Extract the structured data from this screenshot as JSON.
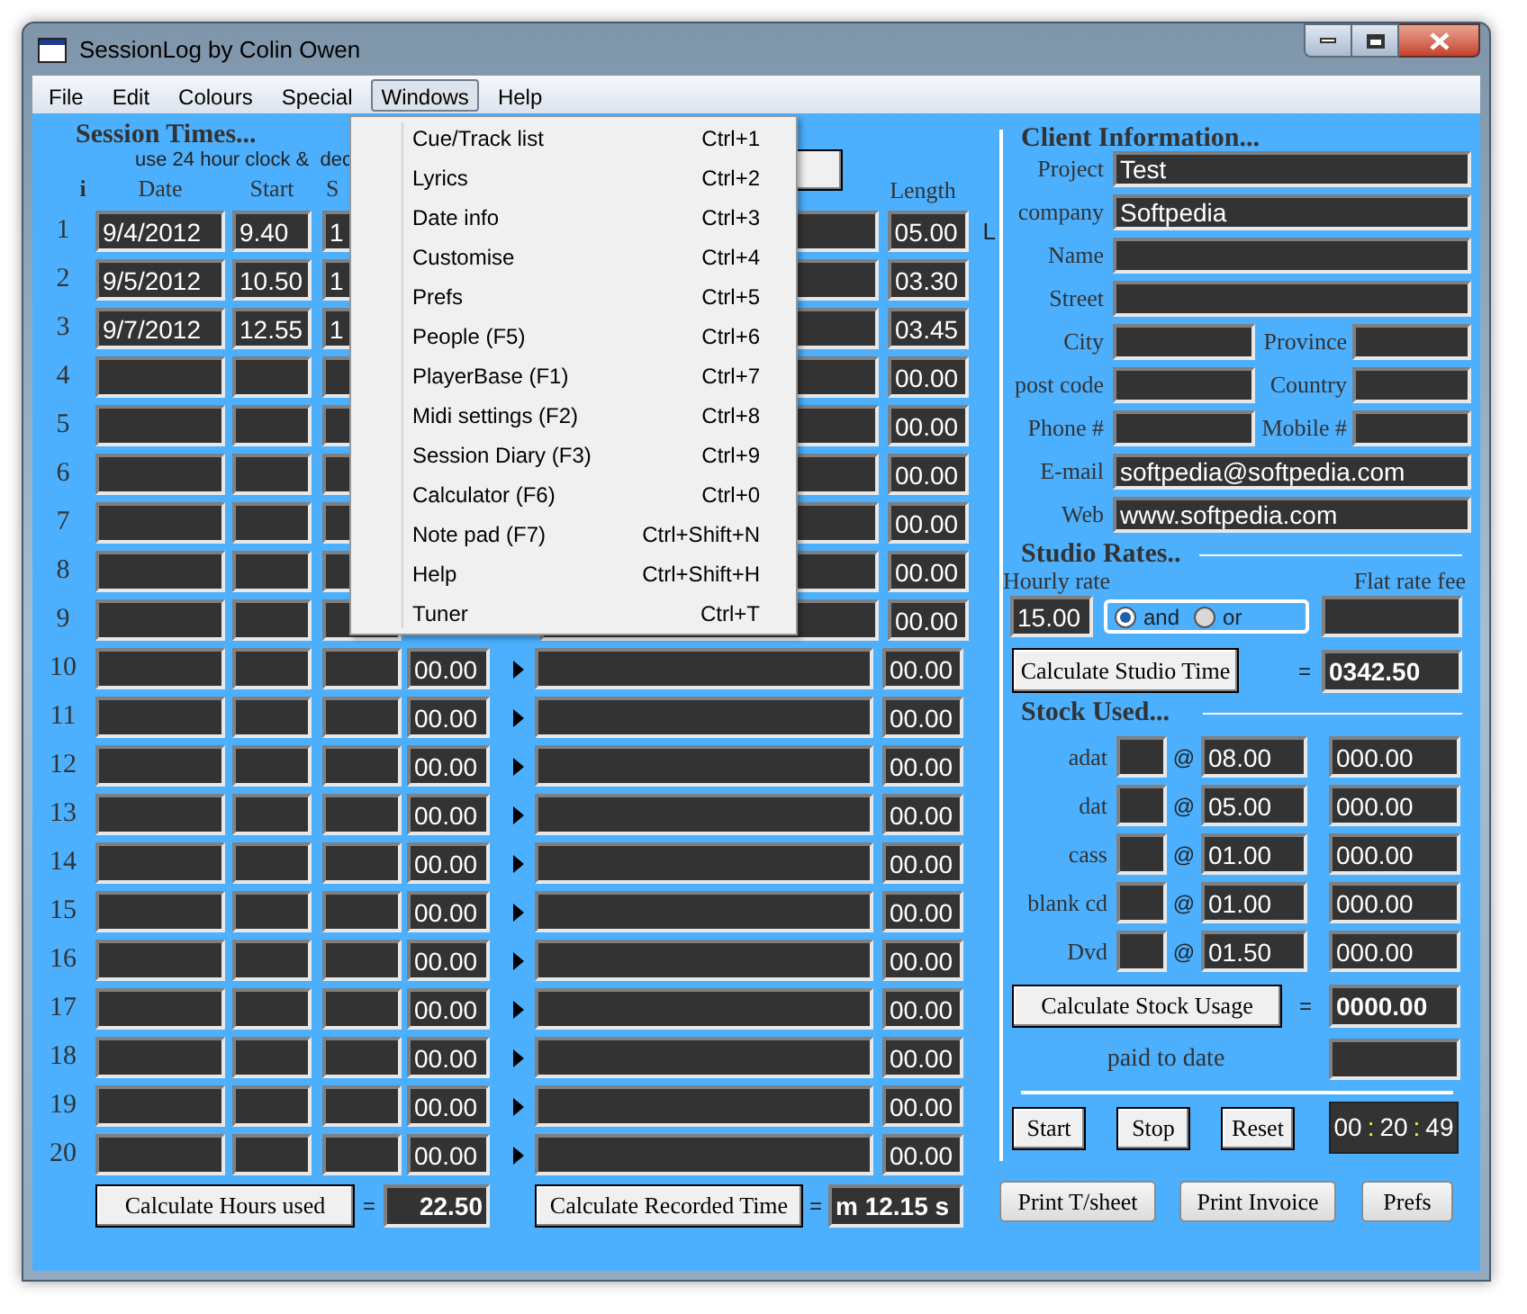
{
  "window": {
    "title": "SessionLog by Colin Owen"
  },
  "menubar": [
    {
      "label": "File",
      "selected": false
    },
    {
      "label": "Edit",
      "selected": false
    },
    {
      "label": "Colours",
      "selected": false
    },
    {
      "label": "Special",
      "selected": false
    },
    {
      "label": "Windows",
      "selected": true
    },
    {
      "label": "Help",
      "selected": false
    }
  ],
  "windows_menu": [
    {
      "label": "Cue/Track list",
      "shortcut": "Ctrl+1"
    },
    {
      "label": "Lyrics",
      "shortcut": "Ctrl+2"
    },
    {
      "label": "Date info",
      "shortcut": "Ctrl+3"
    },
    {
      "label": "Customise",
      "shortcut": "Ctrl+4"
    },
    {
      "label": "Prefs",
      "shortcut": "Ctrl+5"
    },
    {
      "label": "People (F5)",
      "shortcut": "Ctrl+6"
    },
    {
      "label": "PlayerBase (F1)",
      "shortcut": "Ctrl+7"
    },
    {
      "label": "Midi settings (F2)",
      "shortcut": "Ctrl+8"
    },
    {
      "label": "Session Diary (F3)",
      "shortcut": "Ctrl+9"
    },
    {
      "label": "Calculator (F6)",
      "shortcut": "Ctrl+0"
    },
    {
      "label": "Note pad (F7)",
      "shortcut": "Ctrl+Shift+N"
    },
    {
      "label": "Help",
      "shortcut": "Ctrl+Shift+H"
    },
    {
      "label": "Tuner",
      "shortcut": "Ctrl+T"
    }
  ],
  "session": {
    "heading": "Session Times...",
    "hint": "use 24 hour clock &  dec",
    "columns": {
      "index": "i",
      "date": "Date",
      "start": "Start",
      "column_4": "S",
      "length": "Length"
    },
    "rows": [
      {
        "number": "1",
        "date": "9/4/2012",
        "start": "9.40",
        "column_4": "1",
        "length": "05.00",
        "note": "L"
      },
      {
        "number": "2",
        "date": "9/5/2012",
        "start": "10.50",
        "column_4": "1",
        "length": "03.30"
      },
      {
        "number": "3",
        "date": "9/7/2012",
        "start": "12.55",
        "column_4": "1",
        "length": "03.45"
      },
      {
        "number": "4",
        "length": "00.00"
      },
      {
        "number": "5",
        "length": "00.00"
      },
      {
        "number": "6",
        "length": "00.00"
      },
      {
        "number": "7",
        "length": "00.00"
      },
      {
        "number": "8",
        "length": "00.00"
      },
      {
        "number": "9",
        "length": "00.00"
      },
      {
        "number": "10",
        "hours": "00.00",
        "length": "00.00"
      },
      {
        "number": "11",
        "hours": "00.00",
        "length": "00.00"
      },
      {
        "number": "12",
        "hours": "00.00",
        "length": "00.00"
      },
      {
        "number": "13",
        "hours": "00.00",
        "length": "00.00"
      },
      {
        "number": "14",
        "hours": "00.00",
        "length": "00.00"
      },
      {
        "number": "15",
        "hours": "00.00",
        "length": "00.00"
      },
      {
        "number": "16",
        "hours": "00.00",
        "length": "00.00"
      },
      {
        "number": "17",
        "hours": "00.00",
        "length": "00.00"
      },
      {
        "number": "18",
        "hours": "00.00",
        "length": "00.00"
      },
      {
        "number": "19",
        "hours": "00.00",
        "length": "00.00"
      },
      {
        "number": "20",
        "hours": "00.00",
        "length": "00.00"
      }
    ],
    "hours_button": "Calculate Hours used",
    "hours_equals": "=",
    "hours_total": "22.50",
    "recorded_button": "Calculate Recorded Time",
    "recorded_equals": "=",
    "recorded_total": "m 12.15 s"
  },
  "client": {
    "heading": "Client Information...",
    "fields": [
      {
        "kind": "wide",
        "label": "Project",
        "value": "Test"
      },
      {
        "kind": "wide",
        "label": "company",
        "value": "Softpedia"
      },
      {
        "kind": "wide",
        "label": "Name"
      },
      {
        "kind": "wide",
        "label": "Street"
      },
      {
        "kind": "pair",
        "label": "City",
        "label_2": "Province"
      },
      {
        "kind": "pair",
        "label": "post code",
        "label_2": "Country"
      },
      {
        "kind": "pair",
        "label": "Phone #",
        "label_2": "Mobile #"
      },
      {
        "kind": "wide",
        "label": "E-mail",
        "value": "softpedia@softpedia.com"
      },
      {
        "kind": "wide",
        "label": "Web",
        "value": "www.softpedia.com"
      }
    ]
  },
  "studio_rates": {
    "heading": "Studio Rates..",
    "hourly_label": "Hourly rate",
    "flat_label": "Flat rate fee",
    "hourly": "15.00",
    "options": [
      {
        "label": "and",
        "selected": true
      },
      {
        "label": "or",
        "selected": false
      }
    ],
    "calculate_button": "Calculate Studio Time",
    "equals": "=",
    "total": "0342.50"
  },
  "stock": {
    "heading": "Stock Used...",
    "rows": [
      {
        "label": "adat",
        "at": "@",
        "price": "08.00",
        "total": "000.00"
      },
      {
        "label": "dat",
        "at": "@",
        "price": "05.00",
        "total": "000.00"
      },
      {
        "label": "cass",
        "at": "@",
        "price": "01.00",
        "total": "000.00"
      },
      {
        "label": "blank cd",
        "at": "@",
        "price": "01.00",
        "total": "000.00"
      },
      {
        "label": "Dvd",
        "at": "@",
        "price": "01.50",
        "total": "000.00"
      }
    ],
    "calculate_button": "Calculate Stock Usage",
    "equals": "=",
    "total": "0000.00",
    "paid_label": "paid to date"
  },
  "timer": {
    "buttons": [
      "Start",
      "Stop",
      "Reset"
    ],
    "hours": "00",
    "minutes": "20",
    "seconds": "49",
    "separator": ":"
  },
  "footer_buttons": [
    "Print T/sheet",
    "Print Invoice",
    "Prefs"
  ]
}
